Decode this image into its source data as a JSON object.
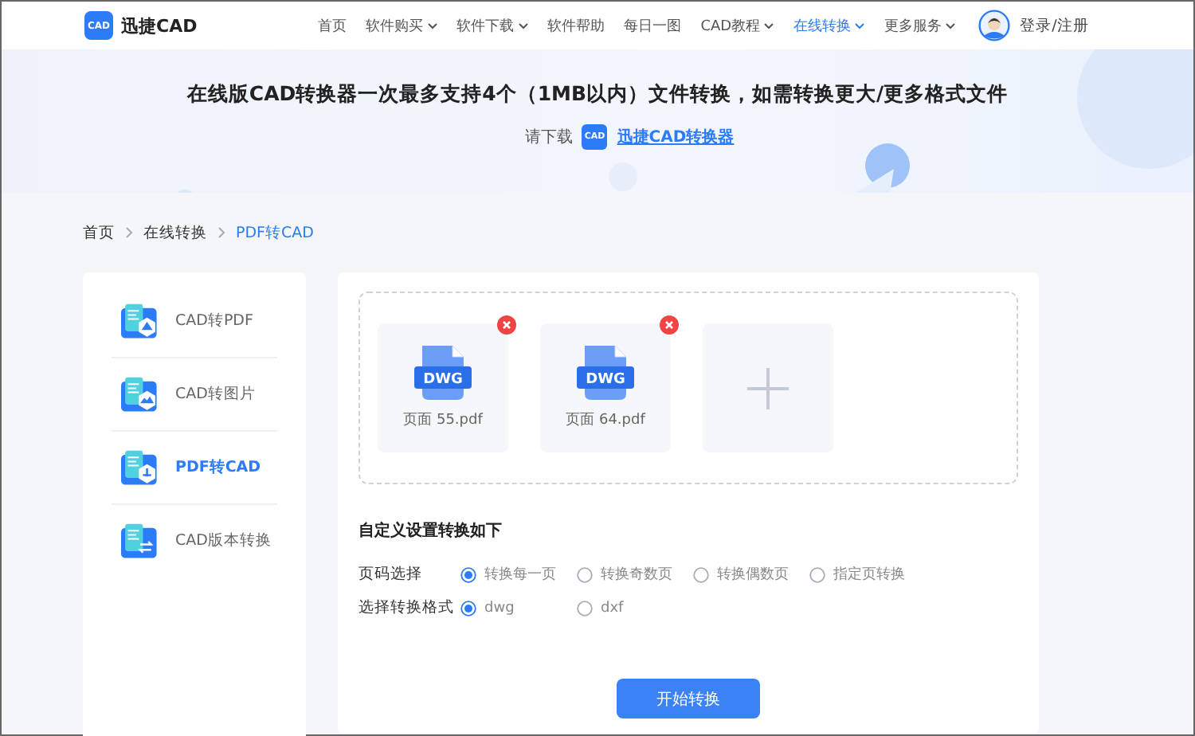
{
  "header": {
    "logo_badge": "CAD",
    "brand": "迅捷CAD",
    "nav": [
      {
        "label": "首页",
        "dropdown": false,
        "selected": false
      },
      {
        "label": "软件购买",
        "dropdown": true,
        "selected": false
      },
      {
        "label": "软件下载",
        "dropdown": true,
        "selected": false
      },
      {
        "label": "软件帮助",
        "dropdown": false,
        "selected": false
      },
      {
        "label": "每日一图",
        "dropdown": false,
        "selected": false
      },
      {
        "label": "CAD教程",
        "dropdown": true,
        "selected": false
      },
      {
        "label": "在线转换",
        "dropdown": true,
        "selected": true
      },
      {
        "label": "更多服务",
        "dropdown": true,
        "selected": false
      }
    ],
    "login": "登录/注册"
  },
  "banner": {
    "headline": "在线版CAD转换器一次最多支持4个（1MB以内）文件转换，如需转换更大/更多格式文件",
    "prompt": "请下载",
    "app_badge": "CAD",
    "download_link": "迅捷CAD转换器"
  },
  "breadcrumb": [
    {
      "label": "首页",
      "selected": false
    },
    {
      "label": "在线转换",
      "selected": false
    },
    {
      "label": "PDF转CAD",
      "selected": true
    }
  ],
  "sidebar": {
    "items": [
      {
        "label": "CAD转PDF",
        "selected": false
      },
      {
        "label": "CAD转图片",
        "selected": false
      },
      {
        "label": "PDF转CAD",
        "selected": true
      },
      {
        "label": "CAD版本转换",
        "selected": false
      }
    ]
  },
  "files": [
    {
      "badge": "DWG",
      "name": "页面 55.pdf"
    },
    {
      "badge": "DWG",
      "name": "页面 64.pdf"
    }
  ],
  "settings": {
    "title": "自定义设置转换如下",
    "rows": [
      {
        "label": "页码选择",
        "options": [
          {
            "label": "转换每一页",
            "selected": true
          },
          {
            "label": "转换奇数页",
            "selected": false
          },
          {
            "label": "转换偶数页",
            "selected": false
          },
          {
            "label": "指定页转换",
            "selected": false
          }
        ]
      },
      {
        "label": "选择转换格式",
        "options": [
          {
            "label": "dwg",
            "selected": true
          },
          {
            "label": "dxf",
            "selected": false
          }
        ]
      }
    ]
  },
  "start_button": "开始转换"
}
